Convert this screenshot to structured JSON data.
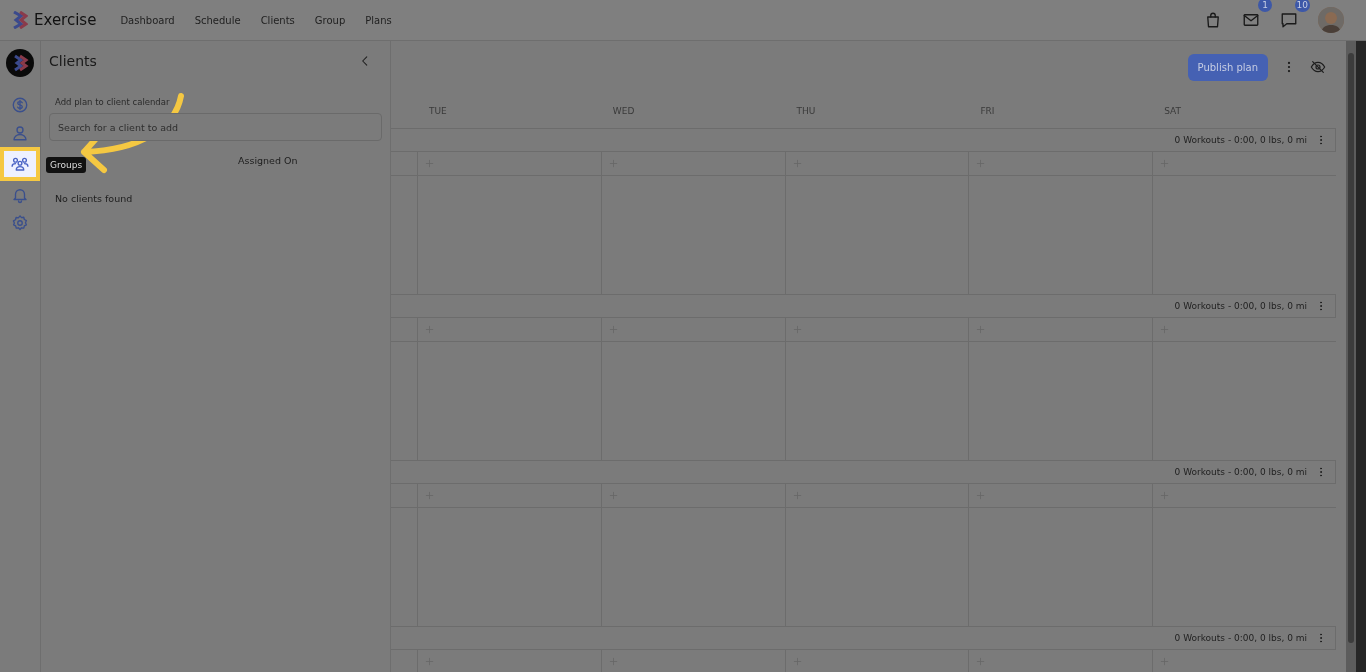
{
  "app": {
    "name": "Exercise"
  },
  "nav": [
    {
      "label": "Dashboard"
    },
    {
      "label": "Schedule"
    },
    {
      "label": "Clients"
    },
    {
      "label": "Group"
    },
    {
      "label": "Plans"
    }
  ],
  "header_actions": {
    "mail_badge": "1",
    "chat_badge": "10"
  },
  "rail": [
    {
      "kind": "billing",
      "selected": false
    },
    {
      "kind": "client",
      "selected": false
    },
    {
      "kind": "groups",
      "selected": true,
      "tooltip": "Groups"
    },
    {
      "kind": "alerts",
      "selected": false
    },
    {
      "kind": "settings",
      "selected": false
    }
  ],
  "panel": {
    "title": "Clients",
    "subtitle": "Add plan to client calendar",
    "search": {
      "placeholder": "Search for a client to add"
    },
    "column": "Assigned On",
    "empty": "No clients found"
  },
  "calendar": {
    "publish": "Publish plan",
    "days": [
      "TUE",
      "WED",
      "THU",
      "FRI",
      "SAT"
    ],
    "weeks": [
      {
        "summary": "0 Workouts - 0:00, 0 lbs, 0 mi"
      },
      {
        "summary": "0 Workouts - 0:00, 0 lbs, 0 mi"
      },
      {
        "summary": "0 Workouts - 0:00, 0 lbs, 0 mi"
      },
      {
        "summary": "0 Workouts - 0:00, 0 lbs, 0 mi"
      }
    ]
  }
}
